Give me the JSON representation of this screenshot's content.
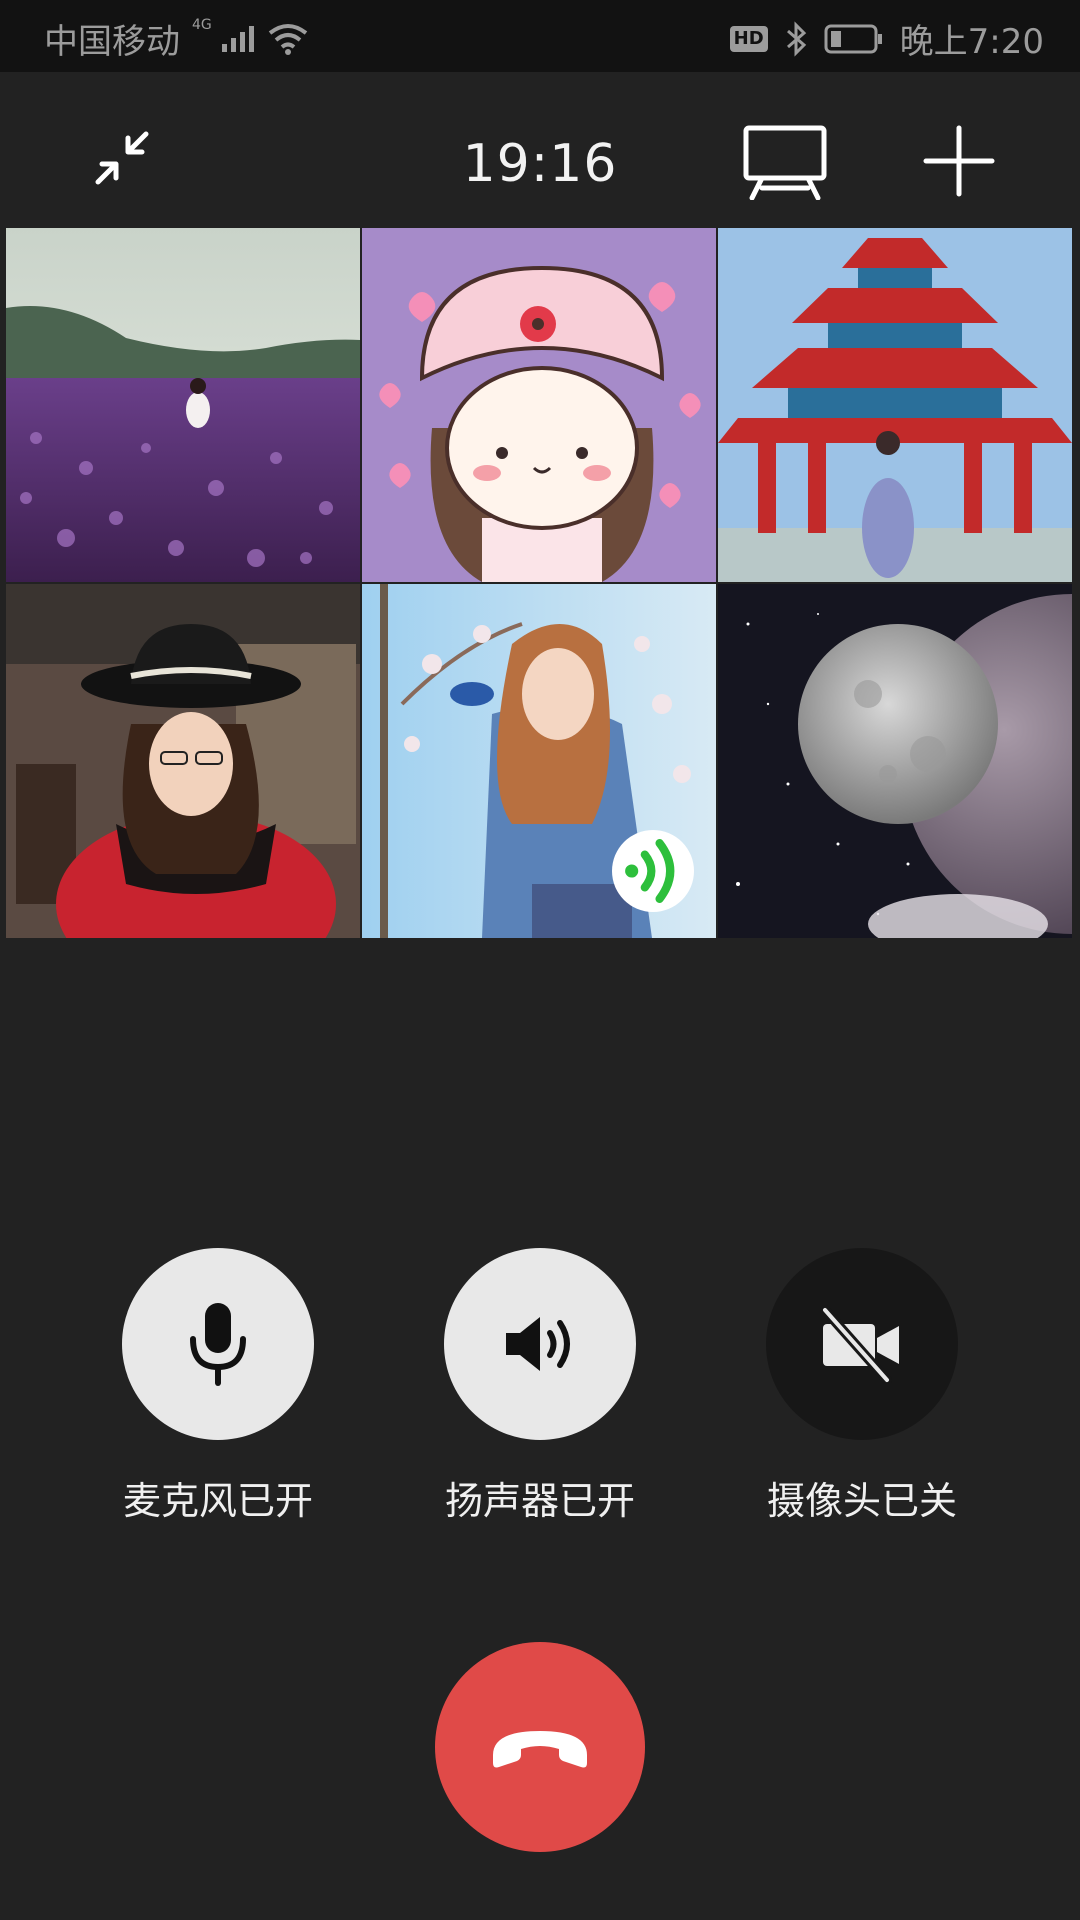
{
  "status_bar": {
    "carrier": "中国移动",
    "network": "4G",
    "time": "晚上7:20",
    "hd_badge": "HD"
  },
  "call": {
    "timer": "19:16"
  },
  "participants": [
    {
      "description_icon": "lavender-field-photo"
    },
    {
      "description_icon": "cartoon-girl-avatar"
    },
    {
      "description_icon": "pagoda-photo"
    },
    {
      "description_icon": "woman-in-hat-photo"
    },
    {
      "description_icon": "woman-blue-sweater-photo",
      "speaking": true
    },
    {
      "description_icon": "moon-space-photo"
    }
  ],
  "controls": {
    "mic_label": "麦克风已开",
    "speaker_label": "扬声器已开",
    "camera_label": "摄像头已关"
  },
  "colors": {
    "background": "#222222",
    "hangup": "#e04a48",
    "speaking_indicator": "#2dbf3c",
    "button_light": "#e8e8e8",
    "button_dark": "#171717"
  }
}
